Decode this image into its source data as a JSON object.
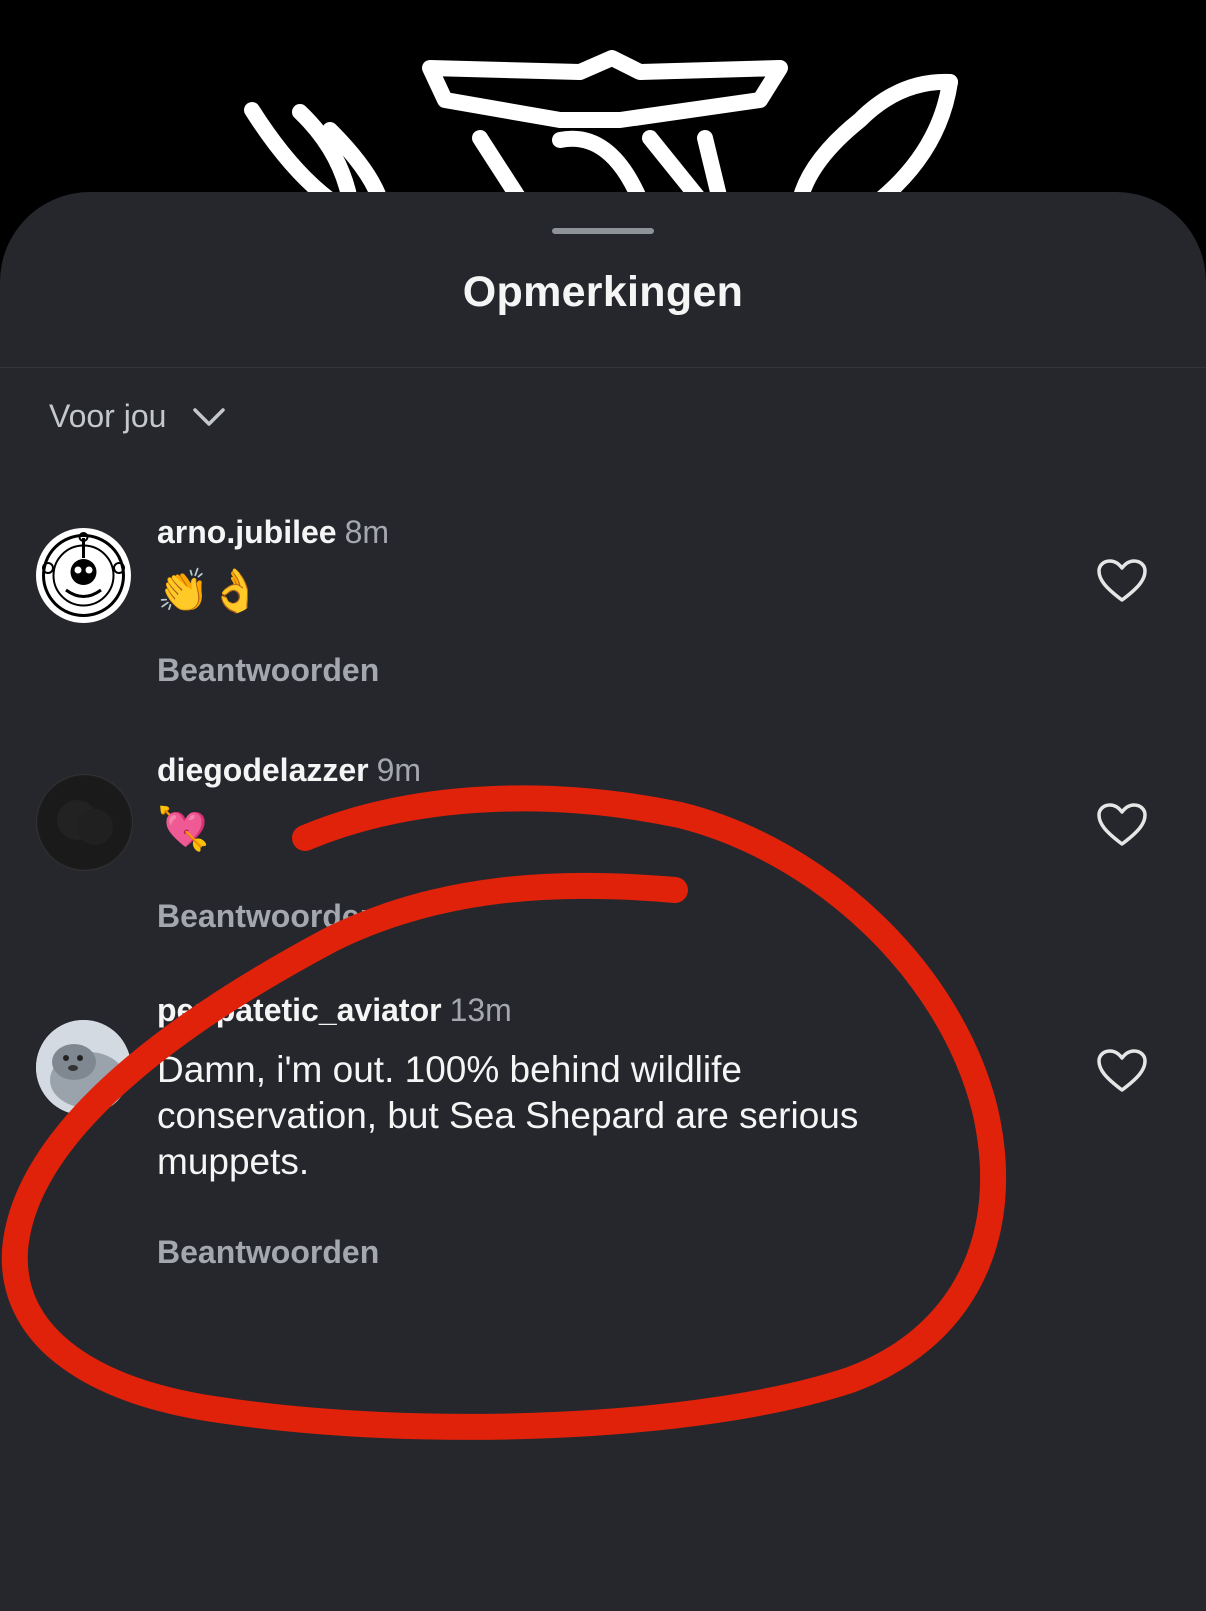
{
  "background": {
    "logo": "logo-graphic"
  },
  "sheet": {
    "title": "Opmerkingen",
    "sort": {
      "label": "Voor jou",
      "icon": "chevron-down-icon"
    }
  },
  "comments": [
    {
      "username": "arno.jubilee",
      "time": "8m",
      "text": "👏👌",
      "reply_label": "Beantwoorden",
      "like_icon": "heart-icon"
    },
    {
      "username": "diegodelazzer",
      "time": "9m",
      "text": "💘",
      "reply_label": "Beantwoorden",
      "like_icon": "heart-icon"
    },
    {
      "username": "peripatetic_aviator",
      "time": "13m",
      "text": "Damn, i'm out.  100% behind wildlife conservation, but Sea Shepard are serious muppets.",
      "reply_label": "Beantwoorden",
      "like_icon": "heart-icon"
    }
  ],
  "colors": {
    "sheet_bg": "#25272c",
    "annotation": "#e0220a",
    "secondary_text": "#a4a8ae"
  }
}
